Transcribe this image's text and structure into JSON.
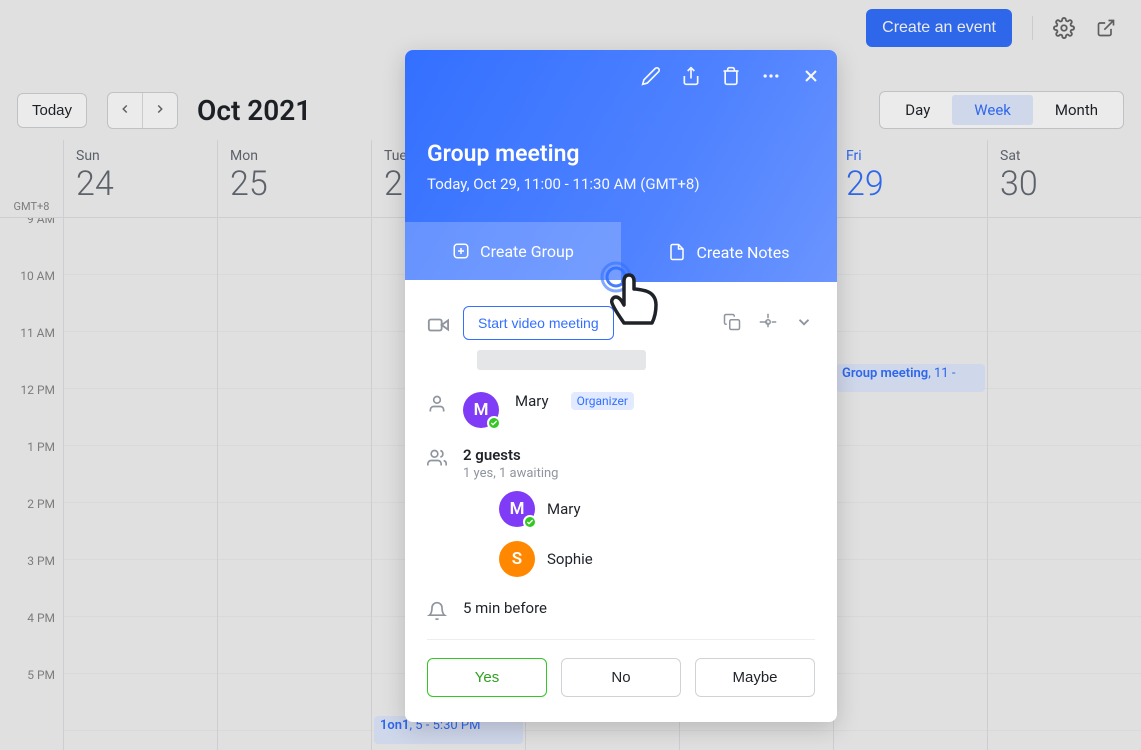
{
  "toolbar": {
    "create_event": "Create an event"
  },
  "nav": {
    "today": "Today",
    "month_title": "Oct 2021"
  },
  "view": {
    "day": "Day",
    "week": "Week",
    "month": "Month"
  },
  "timezone": "GMT+8",
  "days": [
    {
      "name": "Sun",
      "num": "24"
    },
    {
      "name": "Mon",
      "num": "25"
    },
    {
      "name": "Tue",
      "num": "2"
    },
    {
      "name": "",
      "num": ""
    },
    {
      "name": "",
      "num": ""
    },
    {
      "name": "Fri",
      "num": "29"
    },
    {
      "name": "Sat",
      "num": "30"
    }
  ],
  "hours": [
    "9 AM",
    "10 AM",
    "11 AM",
    "12 PM",
    "1 PM",
    "2 PM",
    "3 PM",
    "4 PM",
    "5 PM"
  ],
  "events": {
    "one_on_one": {
      "title": "1on1",
      "time": "5 - 5:30 PM"
    },
    "group": {
      "title": "Group meeting",
      "time": "11 -"
    }
  },
  "popover": {
    "title": "Group meeting",
    "time": "Today, Oct 29, 11:00 - 11:30 AM (GMT+8)",
    "tabs": {
      "create_group": "Create Group",
      "create_notes": "Create Notes"
    },
    "video_btn": "Start video meeting",
    "organizer": {
      "name": "Mary",
      "initial": "M",
      "badge": "Organizer",
      "color": "#7f3bf5"
    },
    "guests": {
      "count": "2 guests",
      "status": "1 yes, 1 awaiting"
    },
    "guest_list": [
      {
        "name": "Mary",
        "initial": "M",
        "color": "#7f3bf5",
        "check": true
      },
      {
        "name": "Sophie",
        "initial": "S",
        "color": "#ff8800",
        "check": false
      }
    ],
    "reminder": "5 min before",
    "rsvp": {
      "yes": "Yes",
      "no": "No",
      "maybe": "Maybe"
    }
  }
}
